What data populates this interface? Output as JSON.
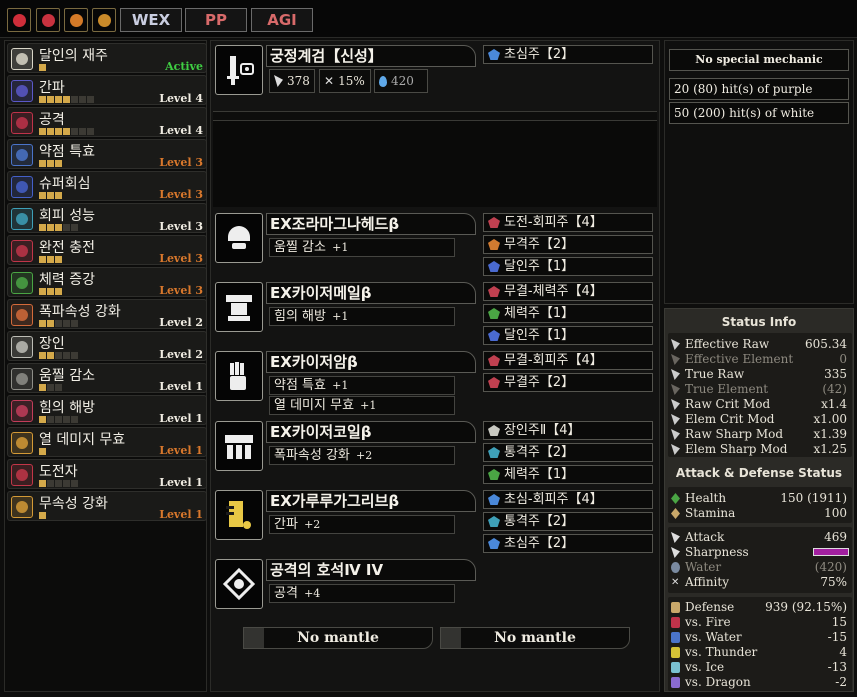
{
  "tags": [
    "WEX",
    "PP",
    "AGI"
  ],
  "flags": [
    {
      "icon": "red-flag-icon",
      "color": "#cf2e3a"
    },
    {
      "icon": "red-flag-icon",
      "color": "#c8323f"
    },
    {
      "icon": "orange-flag-icon",
      "color": "#d47a28"
    },
    {
      "icon": "orange-flag-icon",
      "color": "#c98a2a"
    }
  ],
  "skills": [
    {
      "name": "달인의 재주",
      "level": "Active",
      "pips": 1,
      "max": 0,
      "icon": "skill-master-icon",
      "color": "#d9d6c8",
      "lvcolor": "#3fcf43"
    },
    {
      "name": "간파",
      "level": "Level 4",
      "pips": 4,
      "max": 7,
      "icon": "critical-eye-icon",
      "color": "#5b58c9",
      "lvcolor": "#f0ece2"
    },
    {
      "name": "공격",
      "level": "Level 4",
      "pips": 4,
      "max": 7,
      "icon": "attack-boost-icon",
      "color": "#c0334a",
      "lvcolor": "#f0ece2"
    },
    {
      "name": "약점 특효",
      "level": "Level 3",
      "pips": 3,
      "max": 3,
      "icon": "weakness-exploit-icon",
      "color": "#4a74c9",
      "lvcolor": "#d9782c"
    },
    {
      "name": "슈퍼회심",
      "level": "Level 3",
      "pips": 3,
      "max": 3,
      "icon": "critical-boost-icon",
      "color": "#4460c9",
      "lvcolor": "#d9782c"
    },
    {
      "name": "회피 성능",
      "level": "Level 3",
      "pips": 3,
      "max": 5,
      "icon": "evade-window-icon",
      "color": "#3ea0b8",
      "lvcolor": "#f0ece2"
    },
    {
      "name": "완전 충전",
      "level": "Level 3",
      "pips": 3,
      "max": 3,
      "icon": "maximum-might-icon",
      "color": "#c03549",
      "lvcolor": "#d9782c"
    },
    {
      "name": "체력 증강",
      "level": "Level 3",
      "pips": 3,
      "max": 3,
      "icon": "health-boost-icon",
      "color": "#4aa544",
      "lvcolor": "#d9782c"
    },
    {
      "name": "폭파속성 강화",
      "level": "Level 2",
      "pips": 2,
      "max": 5,
      "icon": "blast-attack-icon",
      "color": "#d36a3a",
      "lvcolor": "#f0ece2"
    },
    {
      "name": "장인",
      "level": "Level 2",
      "pips": 2,
      "max": 5,
      "icon": "handicraft-icon",
      "color": "#bdbdb6",
      "lvcolor": "#f0ece2"
    },
    {
      "name": "움찔 감소",
      "level": "Level 1",
      "pips": 1,
      "max": 3,
      "icon": "flinch-free-icon",
      "color": "#8e8e88",
      "lvcolor": "#f0ece2"
    },
    {
      "name": "힘의 해방",
      "level": "Level 1",
      "pips": 1,
      "max": 5,
      "icon": "latent-power-icon",
      "color": "#c23d5a",
      "lvcolor": "#f0ece2"
    },
    {
      "name": "열 데미지 무효",
      "level": "Level 1",
      "pips": 1,
      "max": 1,
      "icon": "heat-guard-icon",
      "color": "#d49a36",
      "lvcolor": "#d9782c"
    },
    {
      "name": "도전자",
      "level": "Level 1",
      "pips": 1,
      "max": 5,
      "icon": "agitator-icon",
      "color": "#c23648",
      "lvcolor": "#f0ece2"
    },
    {
      "name": "무속성 강화",
      "level": "Level 1",
      "pips": 1,
      "max": 1,
      "icon": "non-elemental-boost-icon",
      "color": "#d49a36",
      "lvcolor": "#d9782c"
    }
  ],
  "weapon": {
    "name": "궁정계검【신성】",
    "attack": "378",
    "affinity": "15%",
    "element": "420",
    "deco": "초심주【2】",
    "deco_color": "#4a88d9"
  },
  "armor": [
    {
      "name": "EX조라마그나헤드β",
      "icon": "helm-icon",
      "skills": [
        {
          "name": "움찔 감소",
          "lv": "+1"
        }
      ],
      "decos": [
        {
          "name": "도전-회피주【4】",
          "color": "#c04050"
        },
        {
          "name": "무격주【2】",
          "color": "#d07a30"
        },
        {
          "name": "달인주【1】",
          "color": "#4a6ad0"
        }
      ]
    },
    {
      "name": "EX카이저메일β",
      "icon": "chest-icon",
      "skills": [
        {
          "name": "힘의 해방",
          "lv": "+1"
        }
      ],
      "decos": [
        {
          "name": "무결-체력주【4】",
          "color": "#c04050"
        },
        {
          "name": "체력주【1】",
          "color": "#4aa544"
        },
        {
          "name": "달인주【1】",
          "color": "#4a6ad0"
        }
      ]
    },
    {
      "name": "EX카이저암β",
      "icon": "arms-icon",
      "skills": [
        {
          "name": "약점 특효",
          "lv": "+1"
        },
        {
          "name": "열 데미지 무효",
          "lv": "+1"
        }
      ],
      "decos": [
        {
          "name": "무결-회피주【4】",
          "color": "#c04050"
        },
        {
          "name": "무결주【2】",
          "color": "#c04050"
        }
      ]
    },
    {
      "name": "EX카이저코일β",
      "icon": "waist-icon",
      "skills": [
        {
          "name": "폭파속성 강화",
          "lv": "+2"
        }
      ],
      "decos": [
        {
          "name": "장인주Ⅱ【4】",
          "color": "#c8c8c0"
        },
        {
          "name": "통격주【2】",
          "color": "#3ea0b8"
        },
        {
          "name": "체력주【1】",
          "color": "#4aa544"
        }
      ]
    },
    {
      "name": "EX가루루가그리브β",
      "icon": "legs-icon",
      "skills": [
        {
          "name": "간파",
          "lv": "+2"
        }
      ],
      "decos": [
        {
          "name": "초심-회피주【4】",
          "color": "#4a88d9"
        },
        {
          "name": "통격주【2】",
          "color": "#3ea0b8"
        },
        {
          "name": "초심주【2】",
          "color": "#4a88d9"
        }
      ]
    },
    {
      "name": "공격의 호석Ⅳ IV",
      "icon": "charm-icon",
      "skills": [
        {
          "name": "공격",
          "lv": "+4"
        }
      ],
      "decos": []
    }
  ],
  "mantles": [
    "No mantle",
    "No mantle"
  ],
  "mechanic": {
    "title": "No special mechanic",
    "lines": [
      "20 (80) hit(s) of purple",
      "50 (200) hit(s) of white"
    ]
  },
  "status": {
    "title": "Status Info",
    "rows": [
      {
        "label": "Effective Raw",
        "value": "605.34",
        "dim": false
      },
      {
        "label": "Effective Element",
        "value": "0",
        "dim": true
      },
      {
        "label": "True Raw",
        "value": "335",
        "dim": false
      },
      {
        "label": "True Element",
        "value": "(42)",
        "dim": true
      },
      {
        "label": "Raw Crit Mod",
        "value": "x1.4",
        "dim": false
      },
      {
        "label": "Elem Crit Mod",
        "value": "x1.00",
        "dim": false
      },
      {
        "label": "Raw Sharp Mod",
        "value": "x1.39",
        "dim": false
      },
      {
        "label": "Elem Sharp Mod",
        "value": "x1.25",
        "dim": false
      }
    ],
    "ad_title": "Attack & Defense Status",
    "health": {
      "label": "Health",
      "value": "150 (1911)"
    },
    "stamina": {
      "label": "Stamina",
      "value": "100"
    },
    "attack": {
      "label": "Attack",
      "value": "469"
    },
    "sharpness": {
      "label": "Sharpness",
      "color": "#a21fa0"
    },
    "water": {
      "label": "Water",
      "value": "(420)"
    },
    "affinity": {
      "label": "Affinity",
      "value": "75%"
    },
    "defense": [
      {
        "label": "Defense",
        "value": "939 (92.15%)"
      },
      {
        "label": "vs. Fire",
        "value": "15"
      },
      {
        "label": "vs. Water",
        "value": "-15"
      },
      {
        "label": "vs. Thunder",
        "value": "4"
      },
      {
        "label": "vs. Ice",
        "value": "-13"
      },
      {
        "label": "vs. Dragon",
        "value": "-2"
      }
    ]
  }
}
